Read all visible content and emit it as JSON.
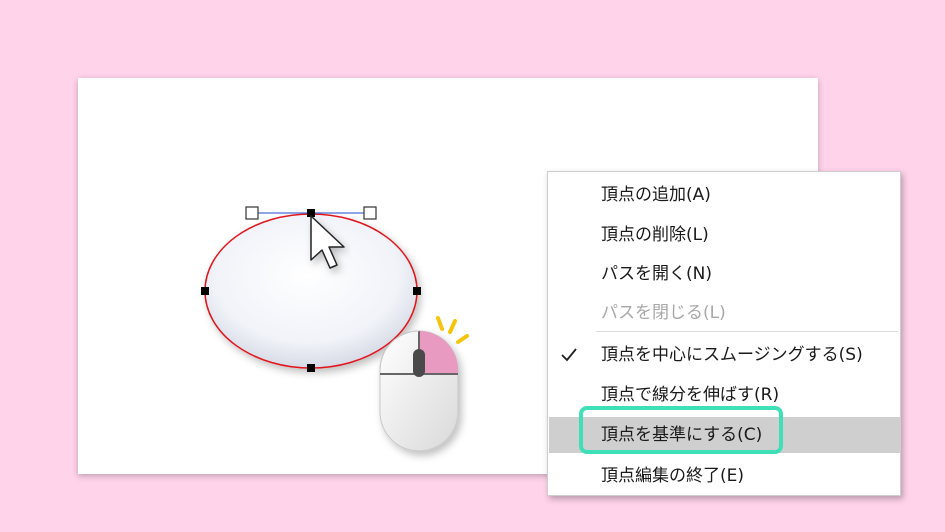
{
  "menu": {
    "items": [
      {
        "label": "頂点の追加(A)",
        "state": "normal"
      },
      {
        "label": "頂点の削除(L)",
        "state": "normal"
      },
      {
        "label": "パスを開く(N)",
        "state": "normal"
      },
      {
        "label": "パスを閉じる(L)",
        "state": "disabled"
      },
      {
        "label": "頂点を中心にスムージングする(S)",
        "state": "checked"
      },
      {
        "label": "頂点で線分を伸ばす(R)",
        "state": "normal"
      },
      {
        "label": "頂点を基準にする(C)",
        "state": "highlighted"
      },
      {
        "label": "頂点編集の終了(E)",
        "state": "normal"
      }
    ]
  },
  "colors": {
    "background": "#ffd3ea",
    "shape_outline": "#e0141e",
    "handle_line": "#4a6fd8",
    "focus_ring": "#3fe0b7",
    "mouse_right_button": "#e89ac0",
    "click_burst": "#f6c40c"
  },
  "icons": {
    "cursor": "arrow-cursor-icon",
    "mouse": "mouse-right-click-icon",
    "check": "check-icon"
  }
}
